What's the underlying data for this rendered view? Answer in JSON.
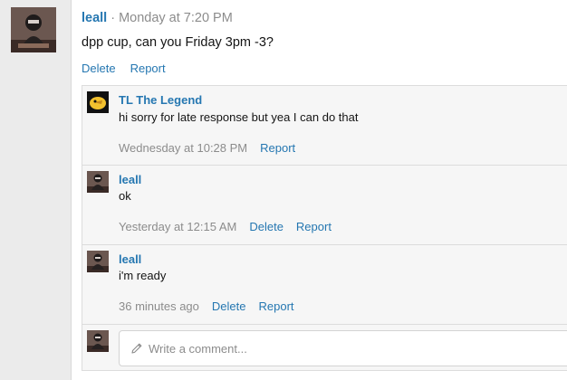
{
  "post": {
    "author": "leall",
    "separator": "·",
    "time": "Monday at 7:20 PM",
    "message": "dpp cup, can you Friday 3pm -3?",
    "actions": {
      "delete": "Delete",
      "report": "Report"
    }
  },
  "comments": [
    {
      "author": "TL The Legend",
      "text": "hi sorry for late response but yea I can do that",
      "time": "Wednesday at 10:28 PM",
      "report": "Report"
    },
    {
      "author": "leall",
      "text": "ok",
      "time": "Yesterday at 12:15 AM",
      "delete": "Delete",
      "report": "Report"
    },
    {
      "author": "leall",
      "text": "i'm ready",
      "time": "36 minutes ago",
      "delete": "Delete",
      "report": "Report"
    }
  ],
  "reply": {
    "placeholder": "Write a comment..."
  },
  "colors": {
    "link": "#2577b1",
    "muted": "#8c8c8c",
    "panel_bg": "#f6f6f6"
  }
}
